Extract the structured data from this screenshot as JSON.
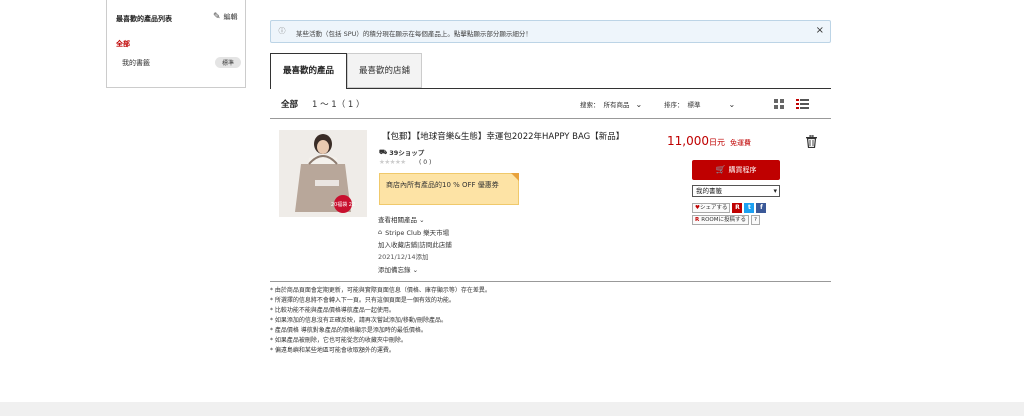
{
  "sidebar": {
    "title": "最喜歡的產品列表",
    "edit_label": "編輯",
    "all_label": "全部",
    "item_label": "我的書籤",
    "item_badge": "標準"
  },
  "notice": {
    "text": "某些活動（包括 SPU）的積分現在顯示在每個產品上。點擊點顯示部分顯示細分！",
    "close": "×"
  },
  "tabs": [
    {
      "label": "最喜歡的產品"
    },
    {
      "label": "最喜歡的店鋪"
    }
  ],
  "toolbar": {
    "all_label": "全部",
    "range": "1 ～ 1（ 1 ）",
    "search_label": "搜索：",
    "search_value": "所有商品",
    "sort_label": "排序：",
    "sort_value": "標準"
  },
  "product": {
    "image_text": "20福袋 22",
    "title": "【包郵】【地球音樂&生態】幸運包2022年HAPPY BAG【新品】",
    "shop": "39ショップ",
    "stars": "★★★★★",
    "reviews": "( 0 )",
    "coupon": "商店內所有產品的10 % OFF 優惠券",
    "related": "查看相關產品",
    "store": "Stripe Club 樂天市場",
    "store_links": [
      "加入收藏店鋪",
      "|",
      "訪問此店鋪"
    ],
    "date": "2021/12/14添加",
    "memo": "添加備忘錄",
    "price": "11,000",
    "price_unit": "日元",
    "shipping": "免運費",
    "buy_label": "購買程序",
    "bookmark_select": "我的書籤",
    "share_label": "シェアする",
    "room_label": "ROOMに投稿する",
    "help_label": "?"
  },
  "notes": [
    "* 由於商品頁面會定期更新，可能與實際頁面信息（價格、庫存顯示等）存在差異。",
    "* 所選擇的信息將不會轉入下一頁。只有這個頁面是一個有效的功能。",
    "* 比較功能不能與產品價格導航產品一起使用。",
    "* 如果添加的信息沒有正確反映，請再次嘗試添加/移動/刪除產品。",
    "* 產品價格 導航對象產品的價格顯示是添加時的最低價格。",
    "* 如果產品被刪除，它也可能從您的收藏夾中刪除。",
    "* 偏遠島嶼和某些地區可能會收取額外的運費。"
  ],
  "colors": {
    "accent": "#bf0000",
    "notice_bg": "#eef5fb",
    "coupon_bg": "#fde3a5"
  }
}
